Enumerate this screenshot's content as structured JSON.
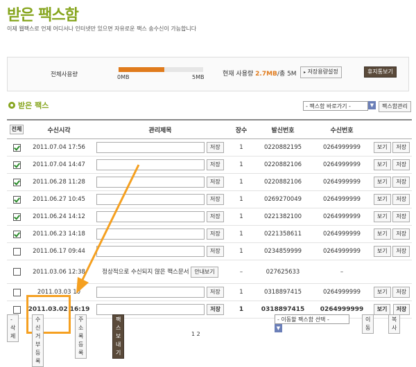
{
  "page": {
    "title": "받은 팩스함",
    "subtitle": "이제 웹팩스로 언제 어디서나 인터넷만 있으면 자유로운 팩스 송수신이 가능합니다"
  },
  "usage": {
    "label": "전체사용량",
    "min_label": "0MB",
    "max_label": "5MB",
    "fill_fraction": 0.54,
    "current_prefix": "현재 사용량",
    "current_value": "2.7MB",
    "current_suffix": "/총 5M",
    "storage_settings_button": "저장용량설정",
    "trash_button": "휴지통보기"
  },
  "section": {
    "title": "받은 팩스",
    "goto_select": "- 팩스함 바로가기 -",
    "manage_button": "팩스함관리"
  },
  "table": {
    "headers": {
      "all": "전체",
      "received_time": "수신시각",
      "memo": "관리제목",
      "pages": "장수",
      "sender": "발신번호",
      "receiver": "수신번호"
    },
    "save_label": "저장",
    "view_label": "보기",
    "rows": [
      {
        "checked": true,
        "time": "2011.07.04 17:56",
        "pages": "1",
        "sender": "0220882195",
        "receiver": "0264999999"
      },
      {
        "checked": true,
        "time": "2011.07.04 14:47",
        "pages": "1",
        "sender": "0220882106",
        "receiver": "0264999999"
      },
      {
        "checked": true,
        "time": "2011.06.28 11:28",
        "pages": "1",
        "sender": "0220882106",
        "receiver": "0264999999"
      },
      {
        "checked": true,
        "time": "2011.06.27 10:45",
        "pages": "1",
        "sender": "0269270049",
        "receiver": "0264999999"
      },
      {
        "checked": true,
        "time": "2011.06.24 14:12",
        "pages": "1",
        "sender": "0221382100",
        "receiver": "0264999999"
      },
      {
        "checked": true,
        "time": "2011.06.23 14:18",
        "pages": "1",
        "sender": "0221358611",
        "receiver": "0264999999"
      },
      {
        "checked": false,
        "time": "2011.06.17 09:44",
        "pages": "1",
        "sender": "0234859999",
        "receiver": "0264999999"
      }
    ],
    "failed_row": {
      "time": "2011.03.06 12:38",
      "message": "정상적으로 수신되지 않은 팩스문서",
      "guide_button": "안내보기",
      "pages": "–",
      "sender": "027625633",
      "receiver": "–"
    },
    "row_9": {
      "time": "2011.03.03 10",
      "pages": "1",
      "sender": "0318897415",
      "receiver": "0264999999"
    },
    "row_10": {
      "time": "2011.03.02 16:19",
      "pages": "1",
      "sender": "0318897415",
      "receiver": "0264999999"
    }
  },
  "bottom": {
    "delete_button": "- 삭제",
    "block_button": "수신거부등록",
    "address_button": "주소록등록",
    "send_button": "팩스보내기",
    "move_select": "- 이동할 팩스함 선택 -",
    "move_button": "이동",
    "copy_button": "복사",
    "pager": "1  2"
  },
  "colors": {
    "accent_green": "#86a51e",
    "usage_orange": "#e07b1c",
    "highlight": "#f5a020"
  }
}
